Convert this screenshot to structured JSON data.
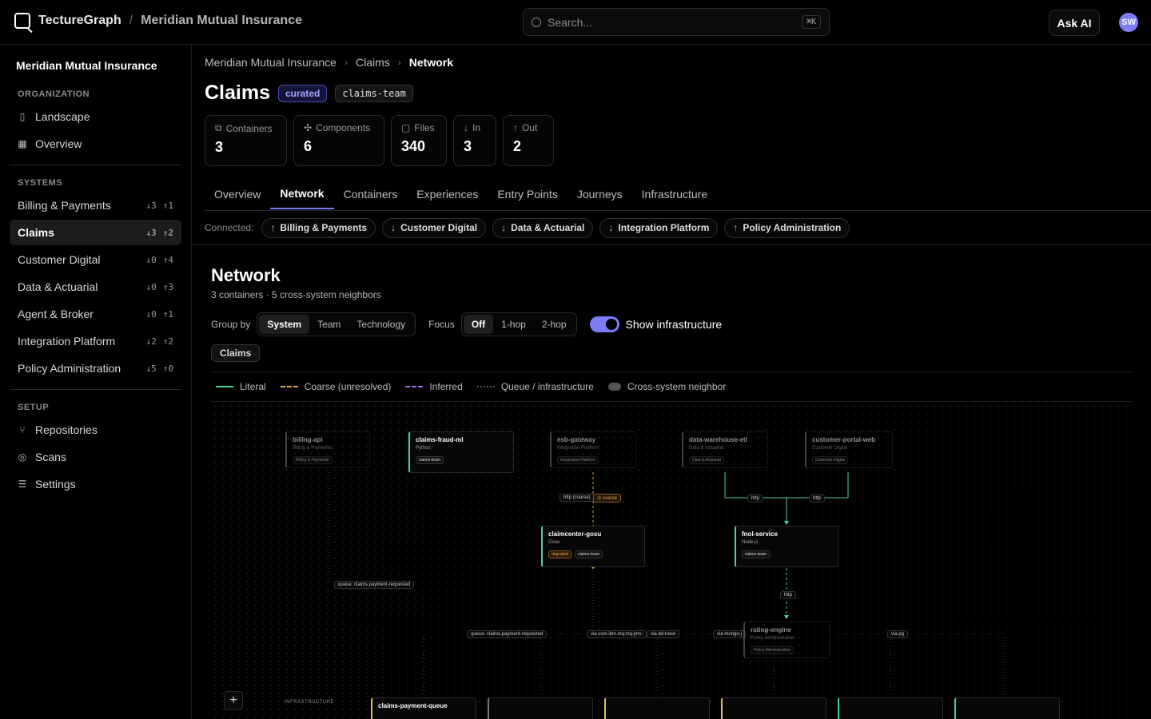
{
  "app": {
    "name": "TectureGraph",
    "org": "Meridian Mutual Insurance"
  },
  "search": {
    "placeholder": "Search...",
    "shortcut": "⌘K"
  },
  "header": {
    "ask_ai": "Ask AI",
    "avatar": "SW"
  },
  "sidebar": {
    "title": "Meridian Mutual Insurance",
    "org_section": "ORGANIZATION",
    "org_items": [
      {
        "label": "Landscape",
        "icon": "map-icon"
      },
      {
        "label": "Overview",
        "icon": "grid-icon"
      }
    ],
    "systems_section": "SYSTEMS",
    "systems": [
      {
        "label": "Billing & Payments",
        "in": "↓3",
        "out": "↑1"
      },
      {
        "label": "Claims",
        "in": "↓3",
        "out": "↑2",
        "active": true
      },
      {
        "label": "Customer Digital",
        "in": "↓0",
        "out": "↑4"
      },
      {
        "label": "Data & Actuarial",
        "in": "↓0",
        "out": "↑3"
      },
      {
        "label": "Agent & Broker",
        "in": "↓0",
        "out": "↑1"
      },
      {
        "label": "Integration Platform",
        "in": "↓2",
        "out": "↑2"
      },
      {
        "label": "Policy Administration",
        "in": "↓5",
        "out": "↑0"
      }
    ],
    "setup_section": "SETUP",
    "setup_items": [
      {
        "label": "Repositories",
        "icon": "git-branch-icon"
      },
      {
        "label": "Scans",
        "icon": "radar-icon"
      },
      {
        "label": "Settings",
        "icon": "sliders-icon"
      }
    ]
  },
  "breadcrumb": [
    "Meridian Mutual Insurance",
    "Claims",
    "Network"
  ],
  "page": {
    "title": "Claims",
    "badge_curated": "curated",
    "badge_team": "claims-team"
  },
  "stats": [
    {
      "label": "Containers",
      "value": "3"
    },
    {
      "label": "Components",
      "value": "6"
    },
    {
      "label": "Files",
      "value": "340"
    },
    {
      "label": "In",
      "value": "3"
    },
    {
      "label": "Out",
      "value": "2"
    }
  ],
  "tabs": [
    "Overview",
    "Network",
    "Containers",
    "Experiences",
    "Entry Points",
    "Journeys",
    "Infrastructure"
  ],
  "connected": {
    "label": "Connected:",
    "chips": [
      {
        "dir": "↑",
        "label": "Billing & Payments"
      },
      {
        "dir": "↓",
        "label": "Customer Digital"
      },
      {
        "dir": "↓",
        "label": "Data & Actuarial"
      },
      {
        "dir": "↓",
        "label": "Integration Platform"
      },
      {
        "dir": "↑",
        "label": "Policy Administration"
      }
    ]
  },
  "network": {
    "title": "Network",
    "subtitle": "3 containers · 5 cross-system neighbors",
    "group_by_label": "Group by",
    "group_by": [
      "System",
      "Team",
      "Technology"
    ],
    "focus_label": "Focus",
    "focus": [
      "Off",
      "1-hop",
      "2-hop"
    ],
    "show_infra": "Show infrastructure",
    "group_chip": "Claims",
    "legend": [
      "Literal",
      "Coarse (unresolved)",
      "Inferred",
      "Queue / infrastructure",
      "Cross-system neighbor"
    ],
    "infra_label": "INFRASTRUCTURE"
  },
  "graph": {
    "nodes": {
      "billing": {
        "name": "billing-api",
        "sys": "Billing & Payments",
        "tag": "Billing & Payments"
      },
      "fraud": {
        "name": "claims-fraud-ml",
        "sys": "Python",
        "tag": "claims-team"
      },
      "esb": {
        "name": "esb-gateway",
        "sys": "Integration Platform",
        "tag": "Integration Platform"
      },
      "dwh": {
        "name": "data-warehouse-etl",
        "sys": "Data & Actuarial",
        "tag": "Data & Actuarial"
      },
      "portal": {
        "name": "customer-portal-web",
        "sys": "Customer Digital",
        "tag": "Customer Digital"
      },
      "claimcenter": {
        "name": "claimcenter-gosu",
        "sys": "Gosu",
        "tag": "claims-team",
        "status": "degraded"
      },
      "fnol": {
        "name": "fnol-service",
        "sys": "Node.js",
        "tag": "claims-team"
      },
      "rating": {
        "name": "rating-engine",
        "sys": "Policy Administration",
        "tag": "Policy Administration"
      },
      "queue": {
        "name": "claims-payment-queue"
      }
    },
    "edge_labels": {
      "http_coarse": "http (coarse)",
      "coarse": "◎ coarse",
      "http1": "http",
      "http2": "http",
      "http3": "http",
      "queue1": "queue: claims.payment-requested",
      "queue2": "queue: claims.payment-requested",
      "mq": "via com.ibm.mq:mq-jms-",
      "dd": "via dd-trace",
      "mongo": "via mongo-j",
      "pg": "via pg"
    },
    "colors": {
      "literal": "#4fd1a5",
      "coarse": "#e0a64a",
      "inferred": "#a66cf0",
      "queue": "#555555",
      "accent": "#7b7cf6"
    }
  }
}
